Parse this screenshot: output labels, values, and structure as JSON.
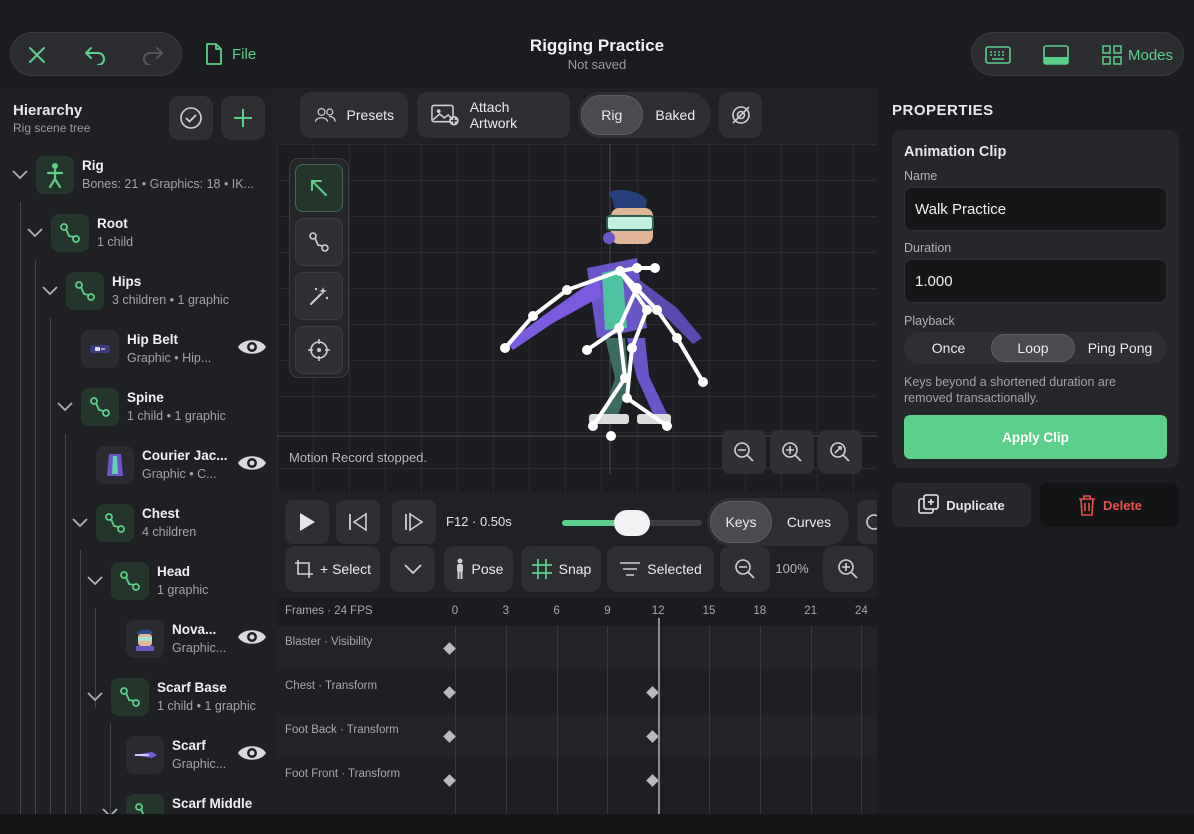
{
  "header": {
    "file_label": "File",
    "title": "Rigging Practice",
    "subtitle": "Not saved",
    "modes_label": "Modes"
  },
  "hierarchy": {
    "title": "Hierarchy",
    "subtitle": "Rig scene tree",
    "nodes": [
      {
        "name": "Rig",
        "meta": "Bones: 21  •  Graphics: 18  •  IK..."
      },
      {
        "name": "Root",
        "meta": "1 child"
      },
      {
        "name": "Hips",
        "meta": "3 children  •  1 graphic"
      },
      {
        "name": "Hip Belt",
        "meta": "Graphic  •  Hip..."
      },
      {
        "name": "Spine",
        "meta": "1 child  •  1 graphic"
      },
      {
        "name": "Courier Jac...",
        "meta": "Graphic  •  C..."
      },
      {
        "name": "Chest",
        "meta": "4 children"
      },
      {
        "name": "Head",
        "meta": "1 graphic"
      },
      {
        "name": "Nova...",
        "meta": "Graphic..."
      },
      {
        "name": "Scarf Base",
        "meta": "1 child  •  1 graphic"
      },
      {
        "name": "Scarf",
        "meta": "Graphic..."
      },
      {
        "name": "Scarf Middle",
        "meta": ""
      }
    ]
  },
  "toolbar": {
    "presets": "Presets",
    "attach": "Attach Artwork",
    "rig": "Rig",
    "baked": "Baked"
  },
  "canvas": {
    "status": "Motion Record stopped."
  },
  "transport": {
    "frame_readout": "F12 · 0.50s",
    "scrub_fraction": 0.5,
    "keys": "Keys",
    "curves": "Curves"
  },
  "edit_row": {
    "select": "+ Select",
    "pose": "Pose",
    "snap": "Snap",
    "selected": "Selected",
    "zoom": "100%"
  },
  "timeline": {
    "header": "Frames · 24 FPS",
    "ticks": [
      "0",
      "3",
      "6",
      "9",
      "12",
      "15",
      "18",
      "21",
      "24"
    ],
    "current_frame": 12,
    "tracks": [
      {
        "label": "Blaster · Visibility",
        "keys": [
          0
        ]
      },
      {
        "label": "Chest · Transform",
        "keys": [
          0,
          12
        ]
      },
      {
        "label": "Foot Back · Transform",
        "keys": [
          0,
          12
        ]
      },
      {
        "label": "Foot Front · Transform",
        "keys": [
          0,
          12
        ]
      }
    ]
  },
  "properties": {
    "title": "PROPERTIES",
    "section": "Animation Clip",
    "name_label": "Name",
    "name_value": "Walk Practice",
    "duration_label": "Duration",
    "duration_value": "1.000",
    "playback_label": "Playback",
    "playback_options": [
      "Once",
      "Loop",
      "Ping Pong"
    ],
    "playback_selected": "Loop",
    "note": "Keys beyond a shortened duration are removed transactionally.",
    "apply": "Apply Clip",
    "duplicate": "Duplicate",
    "delete": "Delete"
  },
  "colors": {
    "accent": "#5ccf8a",
    "danger": "#e5534b"
  }
}
